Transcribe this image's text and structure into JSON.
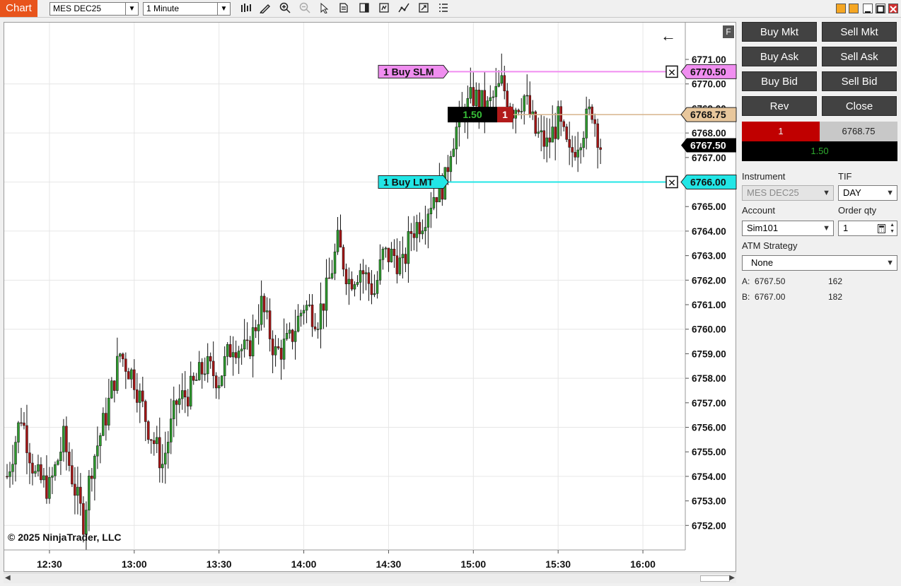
{
  "toolbar": {
    "tab_label": "Chart",
    "instrument_combo": "MES DEC25",
    "interval_combo": "1 Minute",
    "icons": [
      "bar-style-icon",
      "drawing-tool-icon",
      "zoom-in-icon",
      "zoom-out-icon",
      "pointer-icon",
      "data-box-icon",
      "chart-trader-icon",
      "strategies-icon",
      "indicators-icon",
      "templates-icon",
      "properties-icon"
    ]
  },
  "colors": {
    "tab": "#e8541c",
    "up_candle": "#2e9a2e",
    "down_candle": "#a31515",
    "slm_order": "#f08ef0",
    "lmt_order": "#22e6e6",
    "position_price": "#e8c79c",
    "last_price": "#000000",
    "bid_red": "#c00000"
  },
  "chart": {
    "badge": "F",
    "back_arrow": "←",
    "copyright": "© 2025 NinjaTrader, LLC",
    "slm_order": {
      "label": "1 Buy SLM",
      "price": "6770.50",
      "cancel": "✕"
    },
    "lmt_order": {
      "label": "1 Buy LMT",
      "price": "6766.00",
      "cancel": "✕"
    },
    "position": {
      "pnl": "1.50",
      "qty": "1",
      "price": "6768.75"
    },
    "last_price": "6767.50"
  },
  "chart_data": {
    "type": "candlestick",
    "x_ticks": [
      "12:30",
      "13:00",
      "13:30",
      "14:00",
      "14:30",
      "15:00",
      "15:30",
      "16:00"
    ],
    "y_ticks": [
      "6771.00",
      "6770.00",
      "6769.00",
      "6768.00",
      "6767.00",
      "6765.00",
      "6764.00",
      "6763.00",
      "6762.00",
      "6761.00",
      "6760.00",
      "6759.00",
      "6758.00",
      "6757.00",
      "6756.00",
      "6755.00",
      "6754.00",
      "6753.00",
      "6752.00"
    ],
    "ylim": [
      6751.0,
      6772.5
    ],
    "x_start": "12:14",
    "x_end": "16:15",
    "grid": true,
    "close_path": [
      [
        "12:15",
        6754.0
      ],
      [
        "12:20",
        6756.5
      ],
      [
        "12:25",
        6754.0
      ],
      [
        "12:30",
        6753.5
      ],
      [
        "12:35",
        6755.5
      ],
      [
        "12:40",
        6753.0
      ],
      [
        "12:42",
        6752.2
      ],
      [
        "12:45",
        6754.5
      ],
      [
        "12:50",
        6756.5
      ],
      [
        "12:55",
        6759.0
      ],
      [
        "13:00",
        6758.0
      ],
      [
        "13:05",
        6756.0
      ],
      [
        "13:10",
        6754.5
      ],
      [
        "13:15",
        6757.0
      ],
      [
        "13:20",
        6757.5
      ],
      [
        "13:25",
        6758.5
      ],
      [
        "13:30",
        6758.0
      ],
      [
        "13:35",
        6759.5
      ],
      [
        "13:40",
        6759.0
      ],
      [
        "13:45",
        6761.0
      ],
      [
        "13:50",
        6759.0
      ],
      [
        "13:55",
        6759.5
      ],
      [
        "14:00",
        6761.0
      ],
      [
        "14:05",
        6760.5
      ],
      [
        "14:08",
        6761.5
      ],
      [
        "14:12",
        6763.5
      ],
      [
        "14:16",
        6762.0
      ],
      [
        "14:20",
        6762.5
      ],
      [
        "14:25",
        6761.5
      ],
      [
        "14:28",
        6763.0
      ],
      [
        "14:32",
        6763.0
      ],
      [
        "14:35",
        6762.5
      ],
      [
        "14:38",
        6764.0
      ],
      [
        "14:42",
        6764.5
      ],
      [
        "14:46",
        6765.5
      ],
      [
        "14:50",
        6766.0
      ],
      [
        "14:52",
        6767.5
      ],
      [
        "14:55",
        6768.5
      ],
      [
        "15:00",
        6769.5
      ],
      [
        "15:05",
        6769.0
      ],
      [
        "15:10",
        6770.0
      ],
      [
        "15:14",
        6769.0
      ],
      [
        "15:18",
        6769.5
      ],
      [
        "15:22",
        6768.0
      ],
      [
        "15:26",
        6767.5
      ],
      [
        "15:30",
        6768.5
      ],
      [
        "15:34",
        6767.0
      ],
      [
        "15:38",
        6768.0
      ],
      [
        "15:42",
        6769.0
      ],
      [
        "15:45",
        6767.5
      ]
    ]
  },
  "order_panel": {
    "buttons": [
      {
        "label": "Buy Mkt"
      },
      {
        "label": "Sell Mkt"
      },
      {
        "label": "Buy Ask"
      },
      {
        "label": "Sell Ask"
      },
      {
        "label": "Buy Bid"
      },
      {
        "label": "Sell Bid"
      },
      {
        "label": "Rev"
      },
      {
        "label": "Close"
      }
    ],
    "position_qty": "1",
    "position_avg": "6768.75",
    "position_pnl": "1.50",
    "instrument_label": "Instrument",
    "instrument_value": "MES DEC25",
    "tif_label": "TIF",
    "tif_value": "DAY",
    "account_label": "Account",
    "account_value": "Sim101",
    "order_qty_label": "Order qty",
    "order_qty_value": "1",
    "atm_label": "ATM Strategy",
    "atm_value": "None",
    "ask": {
      "label": "A:",
      "price": "6767.50",
      "size": "162"
    },
    "bid": {
      "label": "B:",
      "price": "6767.00",
      "size": "182"
    }
  }
}
